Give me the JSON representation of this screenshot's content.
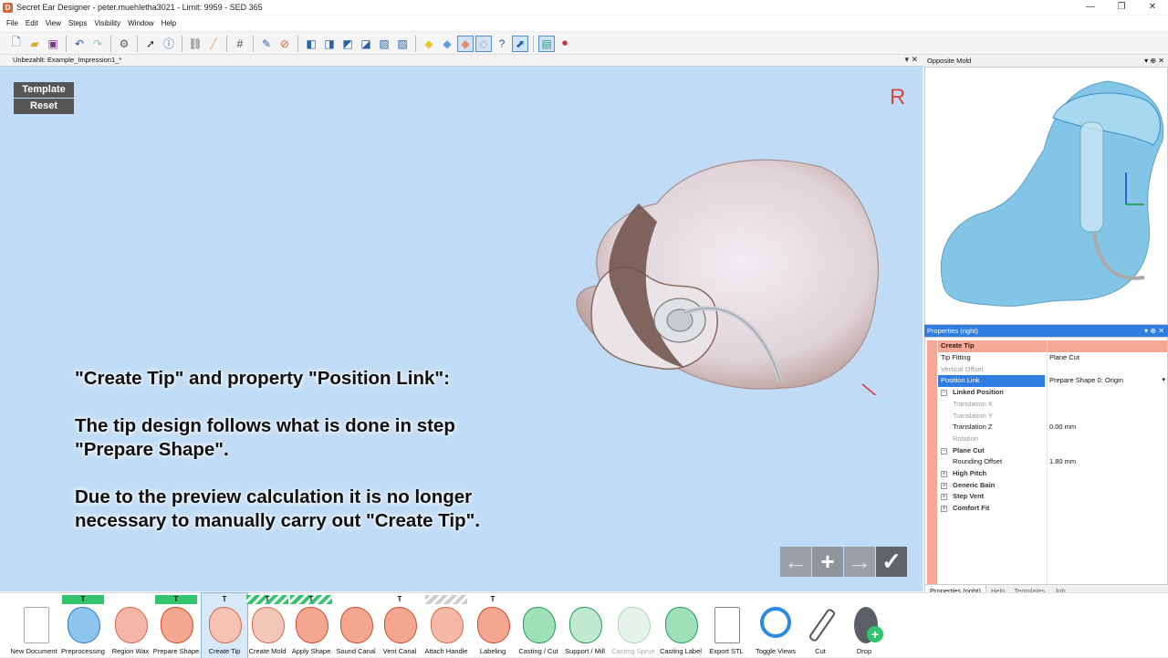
{
  "window": {
    "title": "Secret Ear Designer - peter.muehletha3021 - Limit: 9959 - SED 365",
    "app_icon_letter": "D",
    "controls": [
      "—",
      "❐",
      "✕"
    ]
  },
  "menu": [
    "File",
    "Edit",
    "View",
    "Steps",
    "Visibility",
    "Window",
    "Help"
  ],
  "document_tab": {
    "label": "Unbezahlt: Example_Impression1_*",
    "controls": "▾ ✕"
  },
  "viewport": {
    "template_label": "Template",
    "reset_label": "Reset",
    "side_indicator": "R",
    "caption_line1": "\"Create Tip\" and property \"Position Link\":",
    "caption_line2": "The tip design follows what is done in step",
    "caption_line3": "\"Prepare Shape\".",
    "caption_line4": "Due to the preview calculation it is no longer",
    "caption_line5": "necessary to manually carry out \"Create Tip\".",
    "nav": {
      "back": "←",
      "add": "+",
      "forward": "→",
      "confirm": "✓"
    },
    "colors": {
      "background": "#c0dbf5",
      "shell": "#e9dde0",
      "accent": "#d6483a"
    }
  },
  "opposite_mold": {
    "title": "Opposite Mold",
    "controls": "▾ ⊕ ✕",
    "colors": {
      "mold": "#5ab2e0"
    }
  },
  "properties": {
    "title": "Properties (right)",
    "controls": "▾ ⊕ ✕",
    "rows": {
      "create_tip": "Create Tip",
      "tip_fitting_k": "Tip Fitting",
      "tip_fitting_v": "Plane Cut",
      "vertical_offset_k": "Vertical Offset",
      "position_link_k": "Position Link",
      "position_link_v": "Prepare Shape 0: Origin",
      "linked_position": "Linked Position",
      "translation_x": "Translation X",
      "translation_y": "Translation Y",
      "translation_z_k": "Translation Z",
      "translation_z_v": "0.00 mm",
      "rotation": "Rotation",
      "plane_cut": "Plane Cut",
      "rounding_offset_k": "Rounding Offset",
      "rounding_offset_v": "1.80 mm",
      "high_pitch": "High Pitch",
      "generic_bain": "Generic Bain",
      "step_vent": "Step Vent",
      "comfort_fit": "Comfort Fit"
    },
    "tabs": [
      "Properties (right)",
      "Help",
      "Templates",
      "Job"
    ],
    "colors": {
      "group": "#f3a996",
      "selected": "#2f7de1"
    }
  },
  "steps": [
    {
      "label": "New Document",
      "badge": "",
      "bar": "none"
    },
    {
      "label": "Preprocessing",
      "badge": "T",
      "bar": "green"
    },
    {
      "label": "Region Wax",
      "badge": "",
      "bar": "none"
    },
    {
      "label": "Prepare Shape",
      "badge": "T",
      "bar": "green"
    },
    {
      "label": "Create Tip",
      "badge": "T",
      "bar": "none"
    },
    {
      "label": "Create Mold",
      "badge": "T",
      "bar": "hatch"
    },
    {
      "label": "Apply Shape",
      "badge": "T",
      "bar": "hatch"
    },
    {
      "label": "Sound Canal",
      "badge": "",
      "bar": "none"
    },
    {
      "label": "Vent Canal",
      "badge": "T",
      "bar": "none"
    },
    {
      "label": "Attach Handle",
      "badge": "",
      "bar": "hatchgray"
    },
    {
      "label": "Labeling",
      "badge": "T",
      "bar": "none"
    },
    {
      "label": "Casting / Cut",
      "badge": "",
      "bar": "none"
    },
    {
      "label": "Support / Mill",
      "badge": "",
      "bar": "none"
    },
    {
      "label": "Casting Sprue",
      "badge": "",
      "bar": "none"
    },
    {
      "label": "Casting Label",
      "badge": "",
      "bar": "none"
    },
    {
      "label": "Export STL",
      "badge": "",
      "bar": "none"
    },
    {
      "label": "Toggle Views",
      "badge": "",
      "bar": "none"
    },
    {
      "label": "Cut",
      "badge": "",
      "bar": "none"
    },
    {
      "label": "Drop",
      "badge": "",
      "bar": "none"
    }
  ]
}
